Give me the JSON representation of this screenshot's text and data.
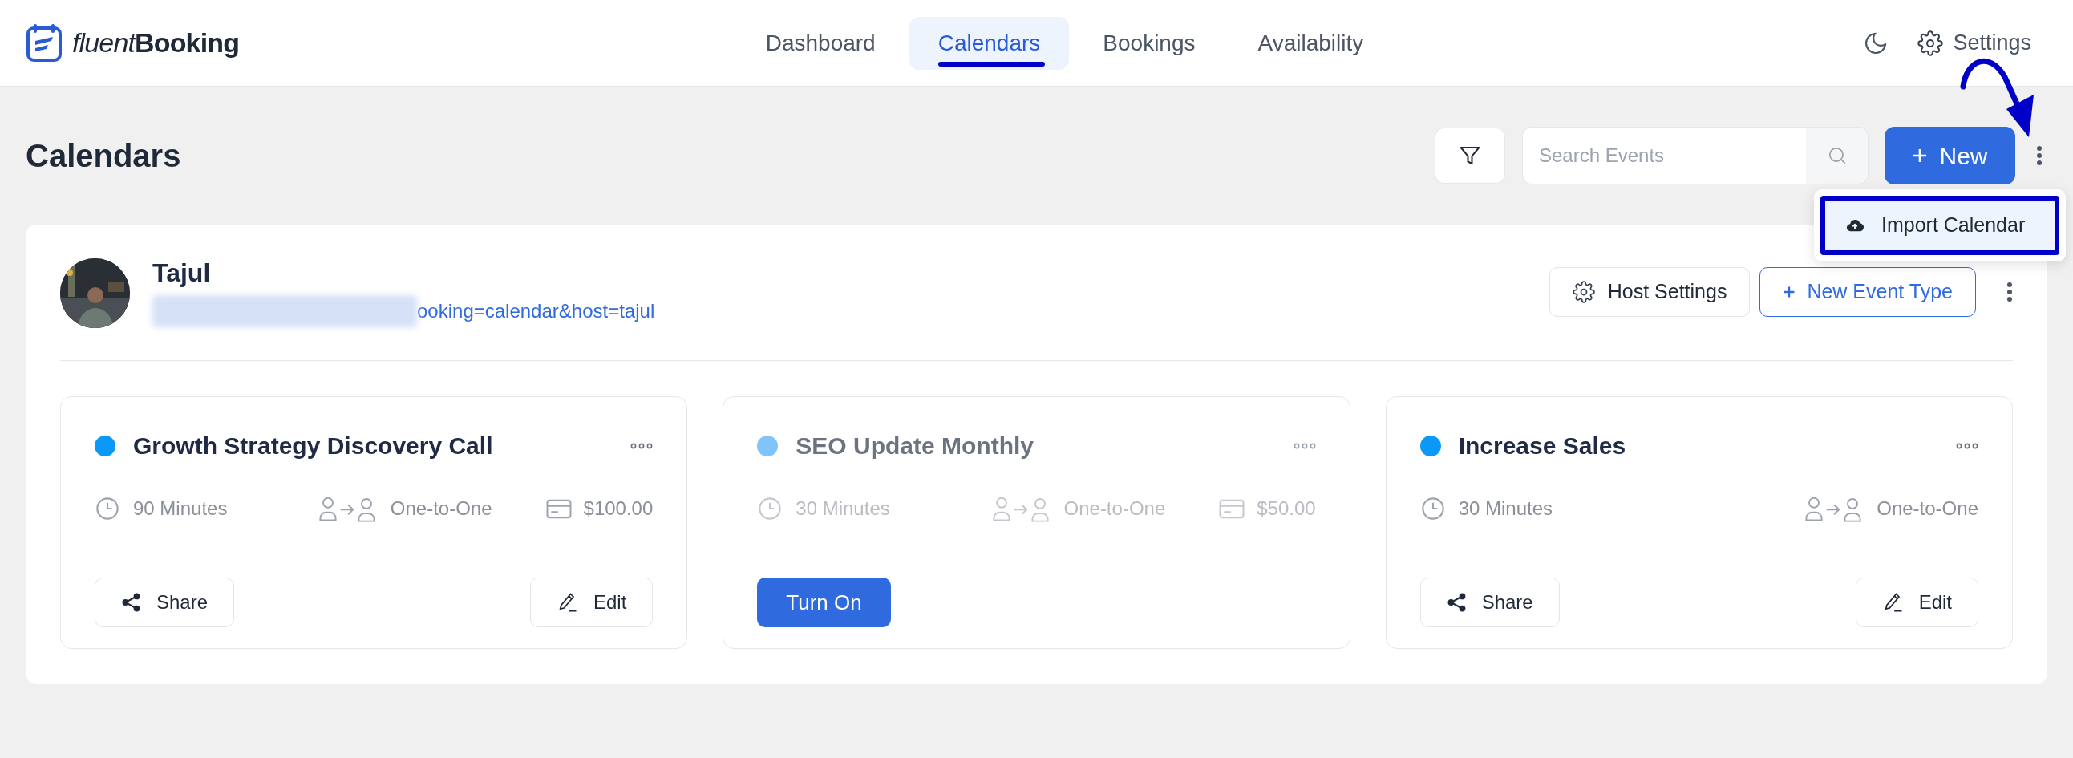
{
  "brand": {
    "prefix": "fluent",
    "name": "Booking"
  },
  "nav": [
    {
      "label": "Dashboard",
      "selected": false
    },
    {
      "label": "Calendars",
      "selected": true
    },
    {
      "label": "Bookings",
      "selected": false
    },
    {
      "label": "Availability",
      "selected": false
    }
  ],
  "settings_link": "Settings",
  "page": {
    "title": "Calendars",
    "search": {
      "placeholder": "Search Events"
    },
    "new_button": "New"
  },
  "menu": {
    "items": [
      {
        "label": "Import Calendar",
        "highlighted": true
      }
    ]
  },
  "host": {
    "name": "Tajul",
    "url": "ooking=calendar&host=tajul",
    "settings_button": "Host Settings",
    "new_event_button": "New Event Type"
  },
  "events": [
    {
      "title": "Growth Strategy Discovery Call",
      "color": "#0a99f6",
      "enabled": true,
      "duration": "90 Minutes",
      "type": "One-to-One",
      "price": "$100.00",
      "actions": [
        "Share",
        "Edit"
      ]
    },
    {
      "title": "SEO Update Monthly",
      "color": "#80c4fa",
      "enabled": false,
      "duration": "30 Minutes",
      "type": "One-to-One",
      "price": "$50.00",
      "actions": [
        "Turn On"
      ]
    },
    {
      "title": "Increase Sales",
      "color": "#0a99f6",
      "enabled": true,
      "duration": "30 Minutes",
      "type": "One-to-One",
      "actions": [
        "Share",
        "Edit"
      ]
    }
  ]
}
